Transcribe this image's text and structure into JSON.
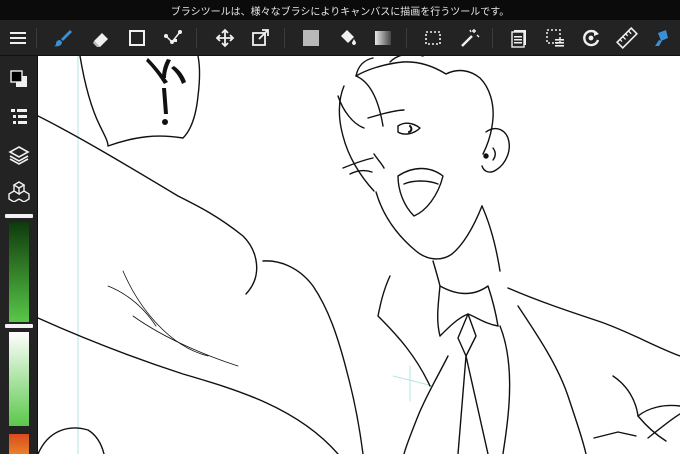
{
  "hint": {
    "text": "ブラシツールは、様々なブラシによりキャンバスに描画を行うツールです。"
  },
  "toolbar": {
    "tools": [
      {
        "name": "menu-icon",
        "active": false
      },
      {
        "name": "brush-tool-icon",
        "active": true
      },
      {
        "name": "eraser-tool-icon",
        "active": false
      },
      {
        "name": "rectangle-tool-icon",
        "active": false
      },
      {
        "name": "correction-tool-icon",
        "active": false
      },
      {
        "name": "move-tool-icon",
        "active": false
      },
      {
        "name": "transform-tool-icon",
        "active": false
      },
      {
        "name": "fill-color-icon",
        "active": false
      },
      {
        "name": "bucket-tool-icon",
        "active": false
      },
      {
        "name": "gradient-tool-icon",
        "active": false
      },
      {
        "name": "select-rect-icon",
        "active": false
      },
      {
        "name": "magic-wand-icon",
        "active": false
      },
      {
        "name": "layer-properties-icon",
        "active": false
      },
      {
        "name": "selection-edit-icon",
        "active": false
      },
      {
        "name": "rotate-view-icon",
        "active": false
      },
      {
        "name": "ruler-icon",
        "active": false
      },
      {
        "name": "spotlight-icon",
        "active": false
      }
    ]
  },
  "sidebar": {
    "items": [
      {
        "name": "color-swatch-icon"
      },
      {
        "name": "brush-list-icon"
      },
      {
        "name": "layers-icon"
      },
      {
        "name": "materials-icon"
      }
    ],
    "slider_top_level": 0.0,
    "slider_bottom_level": 0.0
  },
  "colors": {
    "accent": "#3a8fd6",
    "toolbar_bg": "#232323",
    "canvas_bg": "#ffffff",
    "green_dark": "#0e3a0c",
    "green_light": "#59c748"
  }
}
